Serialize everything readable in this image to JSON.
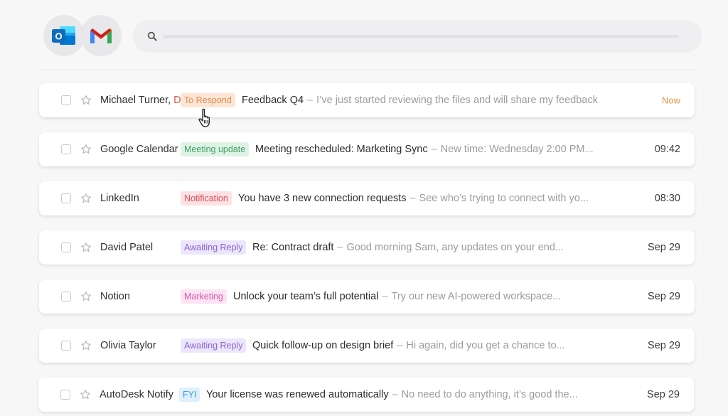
{
  "header": {
    "logos": [
      {
        "icon": "outlook-logo-icon",
        "letter": "O",
        "color": "#0f6cbd"
      },
      {
        "icon": "gmail-logo-icon",
        "colors": [
          "#ea4335",
          "#4285f4",
          "#34a853",
          "#fbbc04"
        ]
      }
    ],
    "search": {
      "icon": "search-icon"
    }
  },
  "emails": [
    {
      "sender": "Michael Turner,",
      "draft": "Draft",
      "tag": "To Respond",
      "tag_style": "respond",
      "subject": "Feedback Q4",
      "dash": "–",
      "preview": "I’ve just started reviewing the files and will share my feedback",
      "time": "Now"
    },
    {
      "sender": "Google Calendar",
      "tag": "Meeting update",
      "tag_style": "meeting",
      "subject": "Meeting rescheduled: Marketing Sync",
      "dash": "–",
      "preview": "New time: Wednesday 2:00 PM...",
      "time": "09:42"
    },
    {
      "sender": "LinkedIn",
      "tag": "Notification",
      "tag_style": "notification",
      "subject": "You have 3 new connection requests",
      "dash": "–",
      "preview": "See who’s trying to connect with yo...",
      "time": "08:30"
    },
    {
      "sender": "David Patel",
      "tag": "Awaiting Reply",
      "tag_style": "awaiting",
      "subject": "Re: Contract draft",
      "dash": "–",
      "preview": "Good morning Sam, any updates on your end...",
      "time": "Sep 29"
    },
    {
      "sender": "Notion",
      "tag": "Marketing",
      "tag_style": "marketing",
      "subject": "Unlock your team’s full potential",
      "dash": "–",
      "preview": "Try our new AI-powered workspace...",
      "time": "Sep 29"
    },
    {
      "sender": "Olivia Taylor",
      "tag": "Awaiting Reply",
      "tag_style": "awaiting",
      "subject": "Quick follow-up on design brief",
      "dash": "–",
      "preview": "Hi again, did you get a chance to...",
      "time": "Sep 29"
    },
    {
      "sender": "AutoDesk Notify",
      "tag": "FYI",
      "tag_style": "fyi",
      "subject": "Your license was renewed automatically",
      "dash": "–",
      "preview": "No need to do anything, it’s good the...",
      "time": "Sep 29"
    }
  ],
  "cursor": {
    "icon": "hand-pointer-cursor-icon"
  }
}
